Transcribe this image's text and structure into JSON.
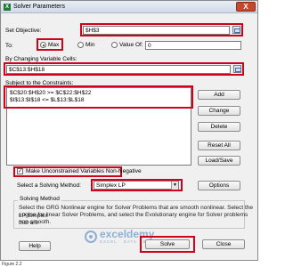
{
  "window": {
    "title": "Solver Parameters",
    "close_label": "X",
    "app_icon": "excel-icon"
  },
  "objective": {
    "label": "Set Objective:",
    "value": "$H$3"
  },
  "to": {
    "label": "To:",
    "options": [
      {
        "label": "Max",
        "selected": true
      },
      {
        "label": "Min",
        "selected": false
      },
      {
        "label": "Value Of:",
        "selected": false
      }
    ],
    "value_of": "0"
  },
  "variables": {
    "label": "By Changing Variable Cells:",
    "value": "$C$13:$H$18"
  },
  "constraints": {
    "label": "Subject to the Constraints:",
    "items": [
      "$C$20:$H$20 >= $C$22:$H$22",
      "$I$13:$I$18 <= $L$13:$L$18"
    ]
  },
  "side_buttons": {
    "add": "Add",
    "change": "Change",
    "delete": "Delete",
    "reset": "Reset All",
    "loadsave": "Load/Save"
  },
  "unconstrained": {
    "label": "Make Unconstrained Variables Non-Negative",
    "checked": true
  },
  "method": {
    "label": "Select a Solving Method:",
    "value": "Simplex LP",
    "options_button": "Options"
  },
  "solving_method": {
    "title": "Solving Method",
    "lines": [
      "Select the GRG Nonlinear engine for Solver Problems that are smooth nonlinear. Select the LP Simplex",
      "engine for linear Solver Problems, and select the Evolutionary engine for Solver problems that are",
      "non-smooth."
    ]
  },
  "footer": {
    "help": "Help",
    "solve": "Solve",
    "close": "Close"
  },
  "watermark": {
    "name": "exceldemy",
    "tagline": "EXCEL · DATA · BI"
  },
  "caption": "Figure 2.2",
  "colors": {
    "highlight": "#d0021b",
    "title_gradient": "#cfd9e8",
    "watermark": "#3d7bbf"
  }
}
